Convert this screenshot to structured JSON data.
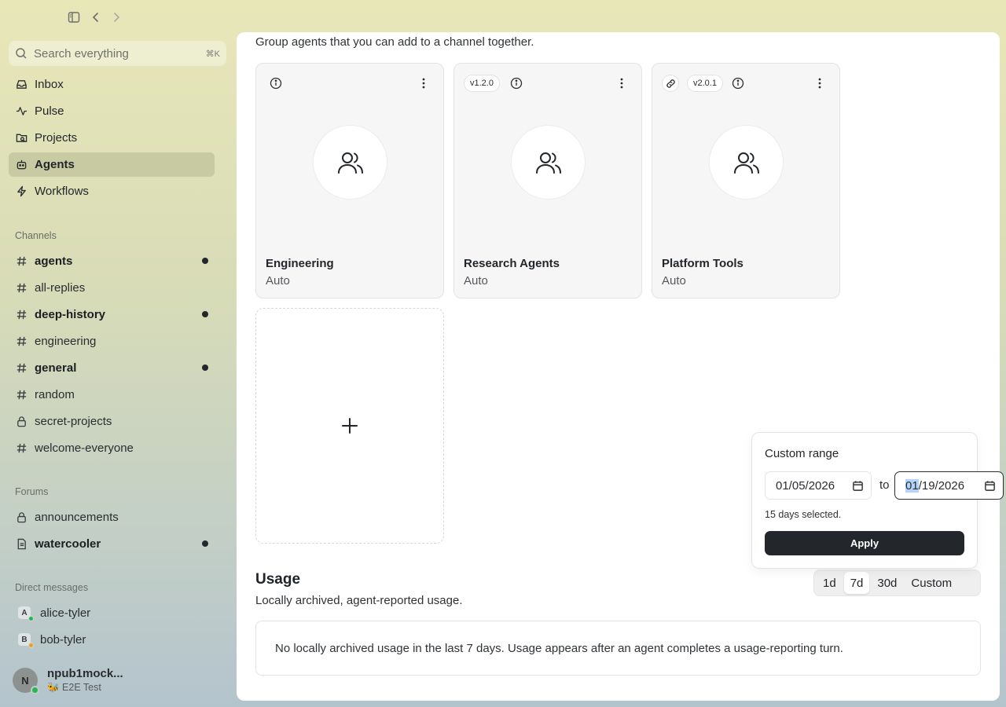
{
  "sidebar": {
    "search": {
      "placeholder": "Search everything",
      "shortcut": "⌘K"
    },
    "nav": [
      {
        "label": "Inbox"
      },
      {
        "label": "Pulse"
      },
      {
        "label": "Projects"
      },
      {
        "label": "Agents",
        "active": true
      },
      {
        "label": "Workflows"
      }
    ],
    "channels_label": "Channels",
    "channels": [
      {
        "label": "agents",
        "unread": true
      },
      {
        "label": "all-replies",
        "unread": false
      },
      {
        "label": "deep-history",
        "unread": true
      },
      {
        "label": "engineering",
        "unread": false
      },
      {
        "label": "general",
        "unread": true
      },
      {
        "label": "random",
        "unread": false
      },
      {
        "label": "secret-projects",
        "private": true,
        "unread": false
      },
      {
        "label": "welcome-everyone",
        "unread": false
      }
    ],
    "forums_label": "Forums",
    "forums": [
      {
        "label": "announcements",
        "unread": false
      },
      {
        "label": "watercooler",
        "unread": true
      }
    ],
    "dm_label": "Direct messages",
    "dms": [
      {
        "initial": "A",
        "label": "alice-tyler",
        "status_color": "#22b85a"
      },
      {
        "initial": "B",
        "label": "bob-tyler",
        "status_color": "#f0a020"
      }
    ],
    "user": {
      "initial": "N",
      "name": "npub1mock...",
      "subtitle": "🐝 E2E Test"
    }
  },
  "main": {
    "intro": "Group agents that you can add to a channel together.",
    "cards": [
      {
        "name": "Engineering",
        "mode": "Auto",
        "version": ""
      },
      {
        "name": "Research Agents",
        "mode": "Auto",
        "version": "v1.2.0"
      },
      {
        "name": "Platform Tools",
        "mode": "Auto",
        "version": "v2.0.1"
      }
    ],
    "usage": {
      "title": "Usage",
      "subtitle": "Locally archived, agent-reported usage.",
      "ranges": [
        "1d",
        "7d",
        "30d",
        "Custom"
      ],
      "selected_range": "7d",
      "empty_message": "No locally archived usage in the last 7 days. Usage appears after an agent completes a usage-reporting turn."
    }
  },
  "popover": {
    "title": "Custom range",
    "from": "01/05/2026",
    "to_label": "to",
    "to_month": "01",
    "to_rest": "/19/2026",
    "days_text": "15 days selected.",
    "apply_label": "Apply"
  },
  "colors": {
    "accent_dark": "#23272b",
    "online": "#22b85a",
    "away": "#f0a020"
  }
}
